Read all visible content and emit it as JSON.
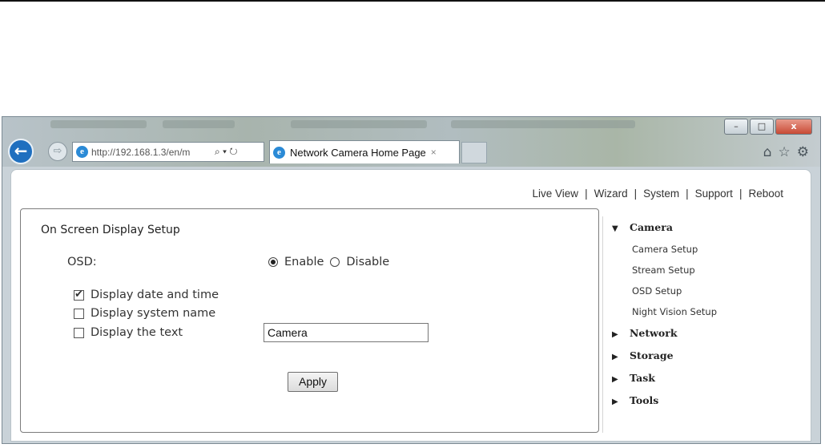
{
  "browser": {
    "address": "http://192.168.1.3/en/m",
    "address_controls": "⌕ ▾ ↻",
    "tab_title": "Network Camera Home Page",
    "tab_close": "×",
    "back_glyph": "←",
    "forward_glyph": "⇨",
    "ie_glyph": "e",
    "window_controls": {
      "minimize": "–",
      "maximize": "□",
      "close": "x"
    },
    "right_icons": {
      "home": "⌂",
      "favorites": "☆",
      "tools": "⚙"
    }
  },
  "topnav": {
    "items": [
      "Live View",
      "Wizard",
      "System",
      "Support",
      "Reboot"
    ],
    "separator": "|"
  },
  "main": {
    "panel_title": "On Screen Display Setup",
    "osd_label": "OSD:",
    "enable_label": "Enable",
    "disable_label": "Disable",
    "enable_selected": true,
    "checkboxes": [
      {
        "label": "Display date and time",
        "checked": true
      },
      {
        "label": "Display system name",
        "checked": false
      },
      {
        "label": "Display the text",
        "checked": false
      }
    ],
    "text_value": "Camera",
    "check_glyph": "✔",
    "apply_label": "Apply"
  },
  "sidebar": {
    "sections": [
      {
        "label": "Camera",
        "expanded": true,
        "arrow": "▼",
        "items": [
          "Camera Setup",
          "Stream Setup",
          "OSD Setup",
          "Night Vision Setup"
        ]
      },
      {
        "label": "Network",
        "expanded": false,
        "arrow": "▶"
      },
      {
        "label": "Storage",
        "expanded": false,
        "arrow": "▶"
      },
      {
        "label": "Task",
        "expanded": false,
        "arrow": "▶"
      },
      {
        "label": "Tools",
        "expanded": false,
        "arrow": "▶"
      }
    ]
  }
}
